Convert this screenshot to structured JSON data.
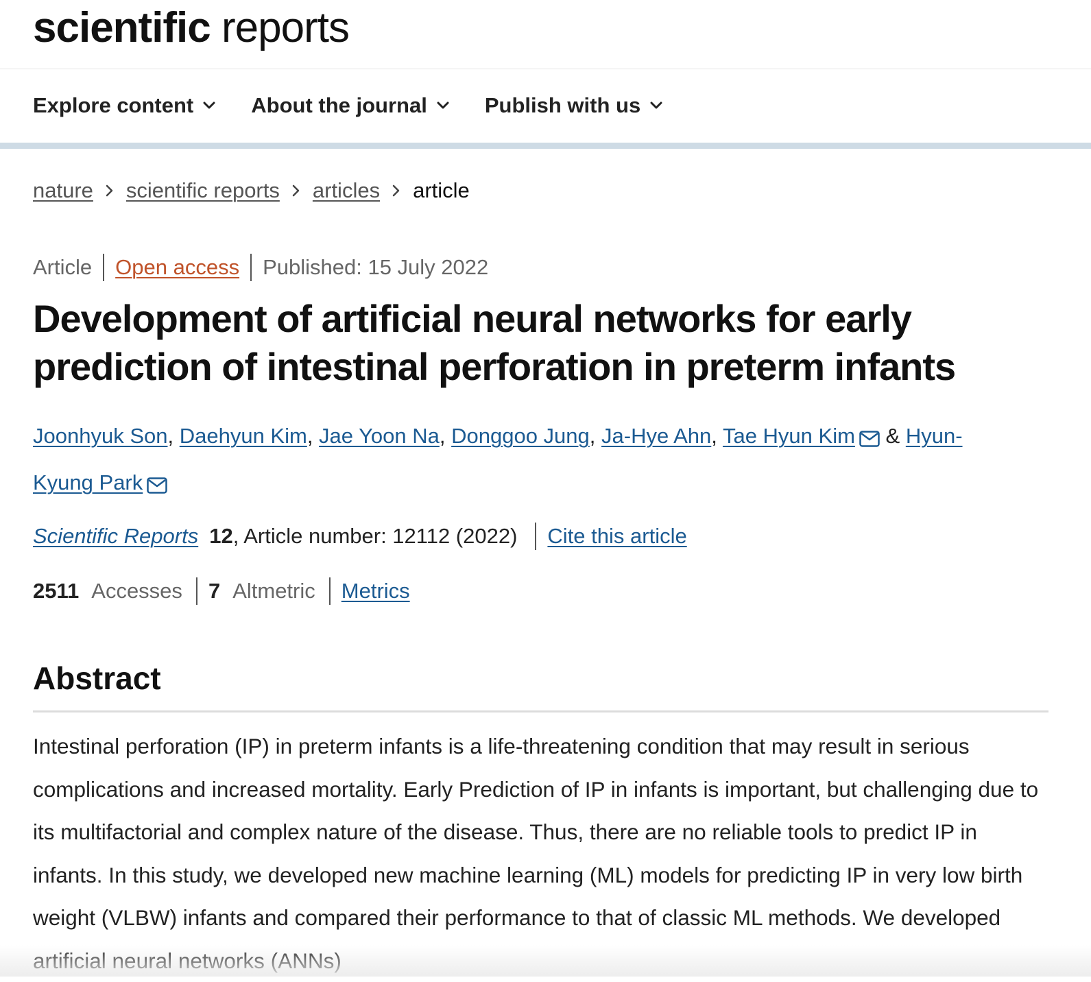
{
  "brand": {
    "bold": "scientific",
    "light": "reports"
  },
  "nav": [
    {
      "label": "Explore content"
    },
    {
      "label": "About the journal"
    },
    {
      "label": "Publish with us"
    }
  ],
  "breadcrumb": {
    "items": [
      "nature",
      "scientific reports",
      "articles"
    ],
    "current": "article"
  },
  "meta": {
    "type": "Article",
    "access": "Open access",
    "published": "Published: 15 July 2022"
  },
  "title": "Development of artificial neural networks for early prediction of intestinal perforation in preterm infants",
  "authors": {
    "list": [
      "Joonhyuk Son",
      "Daehyun Kim",
      "Jae Yoon Na",
      "Donggoo Jung",
      "Ja-Hye Ahn",
      "Tae Hyun Kim",
      "Hyun-Kyung Park"
    ],
    "separator": ", ",
    "last_separator": " & "
  },
  "citation": {
    "journal": "Scientific Reports",
    "volume": "12",
    "article_number": ", Article number: 12112 (2022)",
    "cite_link": "Cite this article"
  },
  "stats": {
    "accesses_count": "2511",
    "accesses_label": "Accesses",
    "altmetric_count": "7",
    "altmetric_label": "Altmetric",
    "metrics_link": "Metrics"
  },
  "abstract": {
    "heading": "Abstract",
    "text": "Intestinal perforation (IP) in preterm infants is a life-threatening condition that may result in serious complications and increased mortality. Early Prediction of IP in infants is important, but challenging due to its multifactorial and complex nature of the disease. Thus, there are no reliable tools to predict IP in infants. In this study, we developed new machine learning (ML) models for predicting IP in very low birth weight (VLBW) infants and compared their performance to that of classic ML methods. We developed artificial neural networks (ANNs)"
  },
  "colors": {
    "link": "#1b5a92",
    "open_access": "#c0532a",
    "nav_band": "#cedbe5"
  },
  "icons": {
    "nav_caret": "chevron-down-icon",
    "crumb_sep": "chevron-right-icon",
    "author_contact": "mail-icon"
  }
}
